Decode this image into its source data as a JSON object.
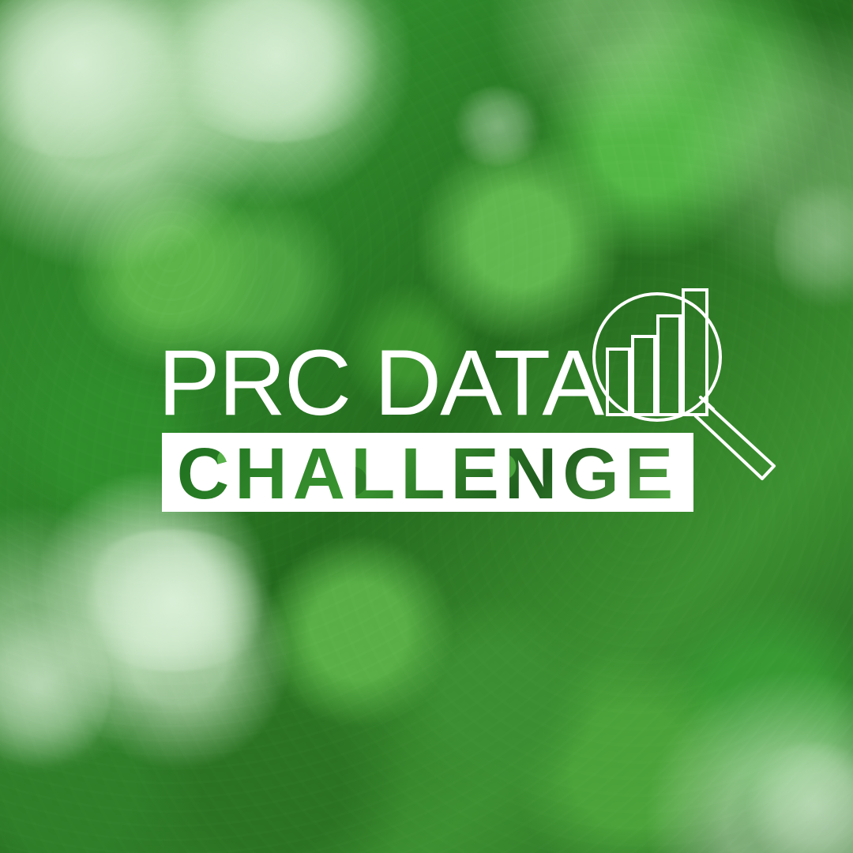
{
  "title": {
    "top_line": "PRC DATA",
    "bottom_line": "CHALLENGE"
  },
  "icons": {
    "magnifier": "magnifying-glass-bar-chart-icon"
  },
  "colors": {
    "logo_white": "#ffffff",
    "forest_dark": "#1f5e1c",
    "forest_mid": "#2f8a2b",
    "forest_light": "#5db54a",
    "mist": "#ddf2dc"
  }
}
